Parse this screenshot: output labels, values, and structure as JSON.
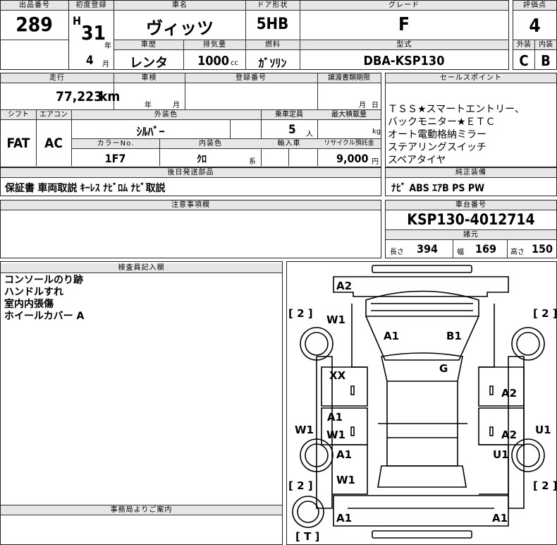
{
  "header": {
    "lot_no_label": "出品番号",
    "lot_no": "289",
    "first_reg_label": "初度登録",
    "era": "H",
    "year": "31",
    "year_unit": "年",
    "month": "4",
    "month_unit": "月",
    "car_name_label": "車名",
    "car_name": "ヴィッツ",
    "door_label": "ドア形状",
    "door": "5HB",
    "grade_label": "グレード",
    "grade": "F",
    "score_label": "評価点",
    "score": "4",
    "history_label": "車歴",
    "history": "レンタ",
    "displacement_label": "排気量",
    "displacement": "1000",
    "displacement_unit": "cc",
    "fuel_label": "燃料",
    "fuel": "ｶﾞｿﾘﾝ",
    "model_label": "型式",
    "model": "DBA-KSP130",
    "exterior_label": "外装",
    "exterior": "C",
    "interior_label": "内装",
    "interior": "B"
  },
  "row2": {
    "mileage_label": "走行",
    "mileage": "77,223",
    "mileage_unit": "km",
    "inspection_label": "車検",
    "insp_year_unit": "年",
    "insp_month_unit": "月",
    "reg_no_label": "登録番号",
    "transfer_label": "譲渡書類期限",
    "transfer_month_unit": "月",
    "transfer_day_unit": "日",
    "shift_label": "シフト",
    "shift": "FAT",
    "ac_label": "エアコン",
    "ac": "AC",
    "color_label": "外装色",
    "color": "ｼﾙﾊﾞｰ",
    "capacity_label": "乗車定員",
    "capacity": "5",
    "capacity_unit": "人",
    "load_label": "最大積載量",
    "load_unit": "kg",
    "color_no_label": "カラーNo.",
    "color_no": "1F7",
    "int_color_label": "内装色",
    "int_color": "ｸﾛ",
    "int_color_unit": "系",
    "import_label": "輸入車",
    "recycle_label": "リサイクル預託金",
    "recycle": "9,000",
    "recycle_unit": "円"
  },
  "sales": {
    "label": "セールスポイント",
    "text": "ＴＳＳ★スマートエントリー、\nバックモニター★ＥＴＣ\nオート電動格納ミラー\nステアリングスイッチ\nスペアタイヤ"
  },
  "later": {
    "label": "後日発送部品",
    "text": "保証書 車両取説 ｷｰﾚｽ ﾅﾋﾞﾛﾑ ﾅﾋﾞ取説"
  },
  "equip": {
    "label": "純正装備",
    "text": "ﾅﾋﾞ ABS ｴｱB PS PW"
  },
  "notes": {
    "label": "注意事項欄"
  },
  "chassis": {
    "label": "車台番号",
    "value": "KSP130-4012714"
  },
  "dims": {
    "label": "諸元",
    "length_label": "長さ",
    "length": "394",
    "width_label": "幅",
    "width": "169",
    "height_label": "高さ",
    "height": "150"
  },
  "inspector": {
    "label": "検査員記入欄",
    "text": "コンソールのり跡\nハンドルすれ\n室内内張傷\nホイールカバー A"
  },
  "office": {
    "label": "事務局よりご案内"
  },
  "diagram": {
    "marks": {
      "a2_top": "A2",
      "w1_fl": "W1",
      "a1_hood": "A1",
      "b1_hood": "B1",
      "g_glass": "G",
      "xx_ldoor": "XX",
      "a2_rdoor": "A2",
      "a1_lrear": "A1",
      "w1_lrear": "W1",
      "w1_lside": "W1",
      "a2_rrear": "A2",
      "u1_rside": "U1",
      "a1_lwheel": "A1",
      "u1_rwheel": "U1",
      "w1_rl": "W1",
      "a1_bl": "A1",
      "a1_br": "A1"
    },
    "tire_fl": "[ 2 ]",
    "tire_fr": "[ 2 ]",
    "tire_rl": "[ 2 ]",
    "tire_rr": "[ 2 ]",
    "spare": "[ T ]"
  }
}
